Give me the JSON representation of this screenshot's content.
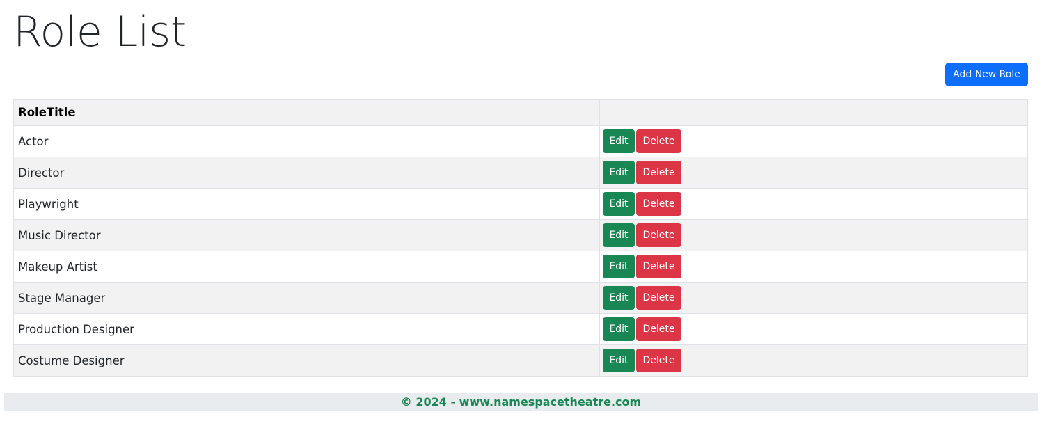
{
  "page": {
    "title": "Role List",
    "add_button_label": "Add New Role"
  },
  "table": {
    "headers": [
      "RoleTitle",
      ""
    ],
    "rows": [
      {
        "role_title": "Actor",
        "edit_label": "Edit",
        "delete_label": "Delete"
      },
      {
        "role_title": "Director",
        "edit_label": "Edit",
        "delete_label": "Delete"
      },
      {
        "role_title": "Playwright",
        "edit_label": "Edit",
        "delete_label": "Delete"
      },
      {
        "role_title": "Music Director",
        "edit_label": "Edit",
        "delete_label": "Delete"
      },
      {
        "role_title": "Makeup Artist",
        "edit_label": "Edit",
        "delete_label": "Delete"
      },
      {
        "role_title": "Stage Manager",
        "edit_label": "Edit",
        "delete_label": "Delete"
      },
      {
        "role_title": "Production Designer",
        "edit_label": "Edit",
        "delete_label": "Delete"
      },
      {
        "role_title": "Costume Designer",
        "edit_label": "Edit",
        "delete_label": "Delete"
      }
    ]
  },
  "footer": {
    "text": "© 2024 - www.namespacetheatre.com"
  },
  "colors": {
    "primary": "#0d6efd",
    "success": "#198754",
    "danger": "#dc3545",
    "footer_bg": "#e9ecef",
    "stripe": "#f2f2f2"
  }
}
